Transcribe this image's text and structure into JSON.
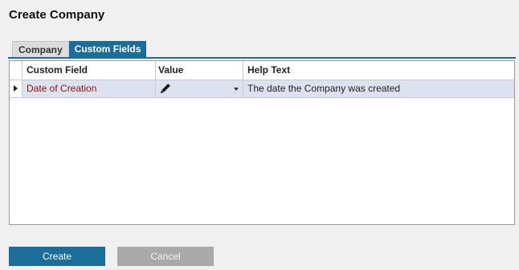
{
  "dialog": {
    "title": "Create Company"
  },
  "tabs": [
    {
      "label": "Company",
      "active": false
    },
    {
      "label": "Custom Fields",
      "active": true
    }
  ],
  "grid": {
    "columns": [
      "Custom Field",
      "Value",
      "Help Text"
    ],
    "rows": [
      {
        "custom_field": "Date of Creation",
        "value": "",
        "help_text": "The date the Company was created",
        "value_icon": "pencil-icon",
        "selected": true
      }
    ]
  },
  "buttons": {
    "create": "Create",
    "cancel": "Cancel"
  },
  "colors": {
    "accent": "#1b6e9a",
    "row_selected": "#dde2f0",
    "field_name": "#8b1010",
    "cancel_button": "#a9a9a9"
  }
}
